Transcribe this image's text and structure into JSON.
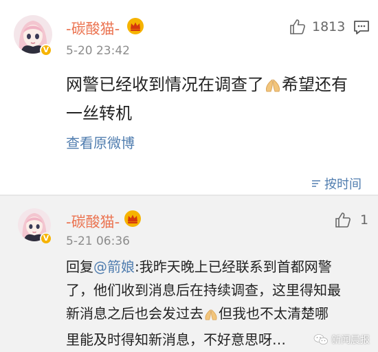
{
  "post": {
    "username": "-碳酸猫-",
    "timestamp": "5-20 23:42",
    "like_count": "1813",
    "text_line1_a": "网警已经收到情况在调查了",
    "text_line1_b": "希望还有",
    "text_line2": "一丝转机",
    "view_original": "查看原微博",
    "sort_label": "按时间",
    "avatar_icon": "girl-avatar-icon",
    "badge_icon": "verified-v-icon",
    "crown_icon": "crown-icon",
    "like_icon": "thumbs-up-icon",
    "comment_icon": "comment-icon",
    "emoji_icon": "pray-hands-emoji"
  },
  "reply": {
    "username": "-碳酸猫-",
    "timestamp": "5-21 06:36",
    "like_count": "1",
    "reply_prefix": "回复",
    "mention": "@箭娘",
    "line1_rest": ":我昨天晚上已经联系到首都网警",
    "line2": "了，他们收到消息后在持续调查，这里得知最",
    "line3_a": "新消息之后也会发过去",
    "line3_b": "但我也不太清楚哪",
    "line4": "里能及时得知新消息，不好意思呀…"
  },
  "watermark": {
    "text": "新闻晨报",
    "icon": "wechat-icon"
  },
  "colors": {
    "username": "#eb7350",
    "link": "#507daf",
    "timestamp": "#8c8c8c",
    "badge": "#f6b300",
    "reply_bg": "#f2f2f2"
  }
}
